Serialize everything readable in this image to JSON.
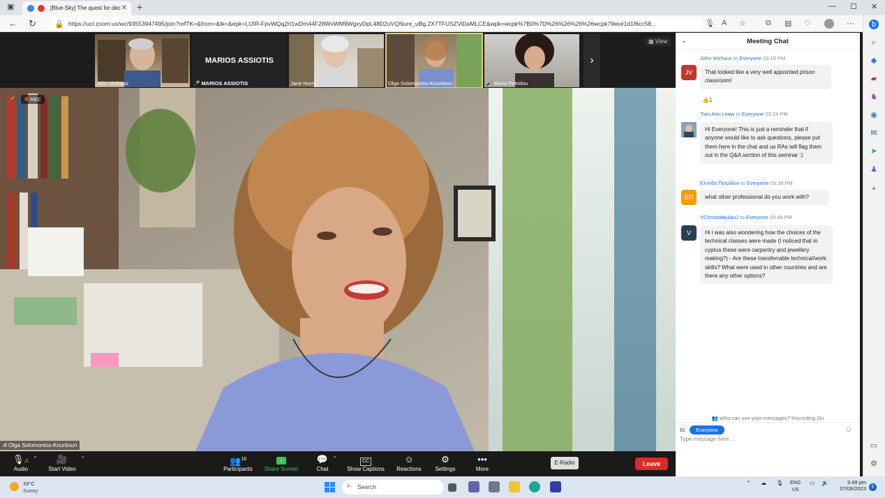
{
  "browser": {
    "tab_title": "[Blue-Sky] The quest for dec",
    "url": "https://ucl.zoom.us/wc/93553947495/join?refTK=&from=&tk=&epk=LIJIR-FpvWQq2rt1wDm44F28WvWM9WgxyDpL48D2uVQNure_uBg.2X7TFUSZViDaMLCE&wpk=wcpk%7B0%7D%26%26%26%26wcpk79ece1d1f6cc58...",
    "new_tab": "+",
    "min": "—",
    "max": "☐",
    "close": "✕"
  },
  "strip": {
    "participants": [
      {
        "name": "John Vorhaus",
        "muted": false
      },
      {
        "name": "MARIOS ASSIOTIS",
        "card_title": "MARIOS ASSIOTIS",
        "muted": true
      },
      {
        "name": "Jane Hurry",
        "muted": false
      },
      {
        "name": "Olga Solomontos-Kountouri",
        "muted": false
      },
      {
        "name": "Maria Petridou",
        "muted": true
      }
    ],
    "next": "›",
    "view_label": "View"
  },
  "main": {
    "rec_label": "REC",
    "speaker": "Olga Solomontos-Kountouri"
  },
  "toolbar": {
    "audio": "Audio",
    "start_video": "Start Video",
    "participants": "Participants",
    "participants_count": "16",
    "share": "Share Screen",
    "chat": "Chat",
    "captions": "Show Captions",
    "reactions": "Reactions",
    "settings": "Settings",
    "more": "More",
    "eradio": "E-Radio",
    "leave": "Leave"
  },
  "chat": {
    "title": "Meeting Chat",
    "to_word": "to",
    "messages": [
      {
        "sender": "John Vorhaus",
        "to": "Everyone",
        "time": "03:18 PM",
        "initials": "JV",
        "color": "#c0392b",
        "text": "That looked like a very well appointed prison classroom!",
        "reaction": "👍1"
      },
      {
        "sender": "Tian Ahn Leow",
        "to": "Everyone",
        "time": "03:24 PM",
        "initials": "",
        "color": "#5b7fa6",
        "text": "Hi Everyone! This is just a reminder that if anyone would like to ask questions, please put them here in the chat and us RAs will flag them out in the Q&A section of this seminar :)"
      },
      {
        "sender": "Ελπίδα Πετρίδου",
        "to": "Everyone",
        "time": "03:39 PM",
        "initials": "ΕΠ",
        "color": "#f39c12",
        "text": "what other professional do you work with?"
      },
      {
        "sender": "VChristodoulou2",
        "to": "Everyone",
        "time": "03:48 PM",
        "initials": "V",
        "color": "#2c3e50",
        "text": "Hi i was also wondering how the choices of the technical classes were made (I noticed that in cyprus these were carpentry and jewellery making?) - Are these transferrable technical/work skills? What were used in other countries and are there any other options?"
      }
    ],
    "who_can_see": "Who can see your messages? Recording On",
    "to_label": "to:",
    "recipient": "Everyone",
    "input_placeholder": "Type message here ..."
  },
  "taskbar": {
    "temp": "33°C",
    "condition": "Sunny",
    "search": "Search",
    "lang": "ENG",
    "region": "US",
    "time": "3:49 pm",
    "date": "07/06/2023",
    "notifications": "5"
  }
}
